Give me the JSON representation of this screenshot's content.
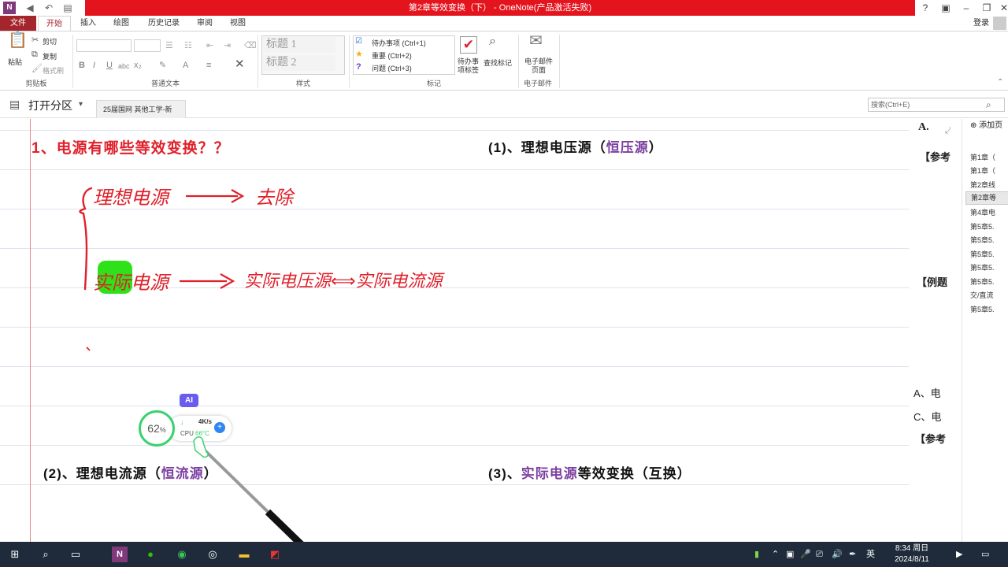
{
  "window": {
    "title": "第2章等效变换（下） - OneNote(产品激活失败)",
    "login": "登录"
  },
  "tabs": [
    "文件",
    "开始",
    "插入",
    "绘图",
    "历史记录",
    "审阅",
    "视图"
  ],
  "ribbon": {
    "clipboard": {
      "paste": "粘贴",
      "cut": "剪切",
      "copy": "复制",
      "format_painter": "格式刷",
      "label": "剪贴板"
    },
    "text": {
      "label": "普通文本"
    },
    "styles": {
      "h1": "标题 1",
      "h2": "标题 2",
      "label": "样式"
    },
    "tags": {
      "todo": "待办事项 (Ctrl+1)",
      "important": "重要 (Ctrl+2)",
      "question": "问题 (Ctrl+3)",
      "todo_tag_btn": "待办事项标签",
      "find_tags": "查找标记",
      "label": "标记"
    },
    "email": {
      "btn": "电子邮件页面",
      "label": "电子邮件"
    }
  },
  "notebook": {
    "open_section": "打开分区",
    "section": "25届国网 其他工学-新",
    "search_placeholder": "搜索(Ctrl+E)"
  },
  "page": {
    "heading1": "1、电源有哪些等效变换？？",
    "ink_ideal": "理想电源",
    "ink_remove": "去除",
    "ink_real": "实际电源",
    "ink_convert": "实际电压源⟺实际电流源",
    "h2_prefix": "(1)、理想电压源（",
    "h2_colored": "恒压源",
    "h2_suffix": "）",
    "h3_prefix": "(2)、理想电流源（",
    "h3_colored": "恒流源",
    "h3_suffix": "）",
    "h4_prefix": "(3)、",
    "h4_colored": "实际电源",
    "h4_suffix": "等效变换（互换）",
    "clip_a1": "A.",
    "clip_ref1": "【参考",
    "clip_example": "【例题",
    "clip_a2": "A、电",
    "clip_c": "C、电",
    "clip_ref2": "【参考"
  },
  "pages_pane": {
    "add_page": "添加页",
    "items": [
      "第1章（",
      "第1章（",
      "第2章线",
      "第2章等",
      "第4章电",
      "第5章5.",
      "第5章5.",
      "第5章5.",
      "第5章5.",
      "第5章5.",
      "交/直流",
      "第5章5."
    ],
    "selected_index": 3
  },
  "cpu_widget": {
    "ai": "AI",
    "percent": "62",
    "percent_unit": "%",
    "net": "4K/s",
    "cpu_label": "CPU",
    "temp": "66°C"
  },
  "taskbar": {
    "ime": "英",
    "time": "8:34 周日",
    "date": "2024/8/11"
  },
  "colors": {
    "accent": "#a4262c",
    "titlebar_red": "#e4141e",
    "ink_red": "#e0202a",
    "purple": "#7b3fa0",
    "highlight_green": "#2ee11a",
    "taskbar": "#1f2b3a"
  }
}
